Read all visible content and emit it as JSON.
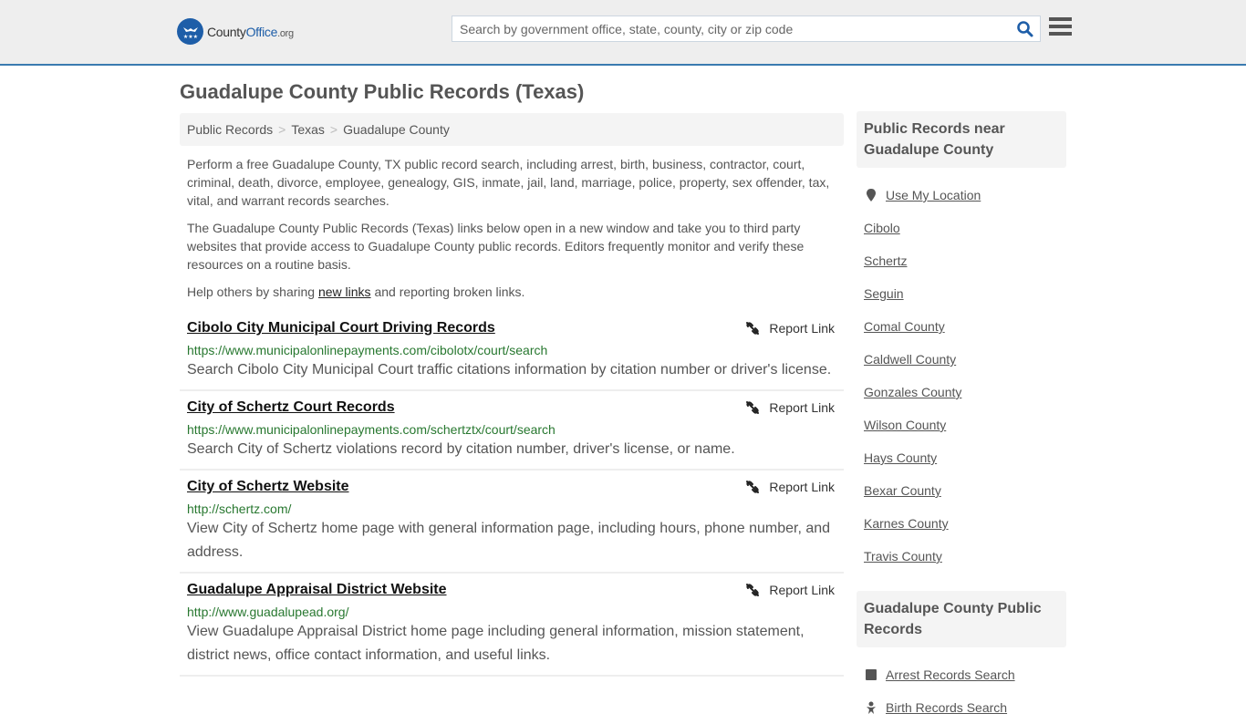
{
  "header": {
    "logo": {
      "name_part1": "County",
      "name_part2": "Office",
      "name_part3": ".org"
    },
    "search": {
      "placeholder": "Search by government office, state, county, city or zip code",
      "value": ""
    },
    "colors": {
      "brand": "#1e5ea8",
      "accent_border": "#3a7bb0"
    }
  },
  "page": {
    "title": "Guadalupe County Public Records (Texas)",
    "breadcrumb": [
      "Public Records",
      "Texas",
      "Guadalupe County"
    ],
    "intro": {
      "p1": "Perform a free Guadalupe County, TX public record search, including arrest, birth, business, contractor, court, criminal, death, divorce, employee, genealogy, GIS, inmate, jail, land, marriage, police, property, sex offender, tax, vital, and warrant records searches.",
      "p2": "The Guadalupe County Public Records (Texas) links below open in a new window and take you to third party websites that provide access to Guadalupe County public records. Editors frequently monitor and verify these resources on a routine basis.",
      "p3_before": "Help others by sharing ",
      "p3_link": "new links",
      "p3_after": " and reporting broken links."
    },
    "report_label": "Report Link",
    "results": [
      {
        "title": "Cibolo City Municipal Court Driving Records",
        "url": "https://www.municipalonlinepayments.com/cibolotx/court/search",
        "desc": "Search Cibolo City Municipal Court traffic citations information by citation number or driver's license."
      },
      {
        "title": "City of Schertz Court Records",
        "url": "https://www.municipalonlinepayments.com/schertztx/court/search",
        "desc": "Search City of Schertz violations record by citation number, driver's license, or name."
      },
      {
        "title": "City of Schertz Website",
        "url": "http://schertz.com/",
        "desc": "View City of Schertz home page with general information page, including hours, phone number, and address."
      },
      {
        "title": "Guadalupe Appraisal District Website",
        "url": "http://www.guadalupead.org/",
        "desc": "View Guadalupe Appraisal District home page including general information, mission statement, district news, office contact information, and useful links."
      }
    ]
  },
  "sidebar": {
    "near": {
      "heading": "Public Records near Guadalupe County",
      "use_location": "Use My Location",
      "places": [
        "Cibolo",
        "Schertz",
        "Seguin",
        "Comal County",
        "Caldwell County",
        "Gonzales County",
        "Wilson County",
        "Hays County",
        "Bexar County",
        "Karnes County",
        "Travis County"
      ]
    },
    "records": {
      "heading": "Guadalupe County Public Records",
      "items": [
        {
          "label": "Arrest Records Search",
          "icon": "square-icon"
        },
        {
          "label": "Birth Records Search",
          "icon": "baby-icon"
        }
      ]
    }
  }
}
